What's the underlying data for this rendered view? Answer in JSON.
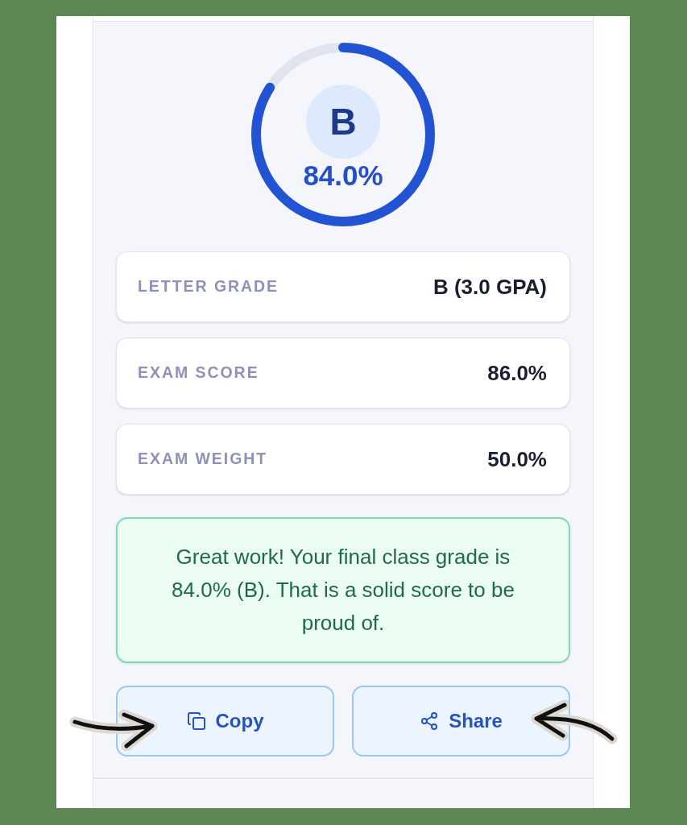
{
  "grade_ring": {
    "letter": "B",
    "percent": "84.0%",
    "level": 0.84
  },
  "stats": [
    {
      "label": "LETTER GRADE",
      "value": "B (3.0 GPA)"
    },
    {
      "label": "EXAM SCORE",
      "value": "86.0%"
    },
    {
      "label": "EXAM WEIGHT",
      "value": "50.0%"
    }
  ],
  "message": {
    "text": "Great work! Your final class grade is 84.0% (B). That is a solid score to be proud of."
  },
  "buttons": [
    {
      "kind": "copy",
      "label": "Copy"
    },
    {
      "kind": "share",
      "label": "Share"
    }
  ]
}
